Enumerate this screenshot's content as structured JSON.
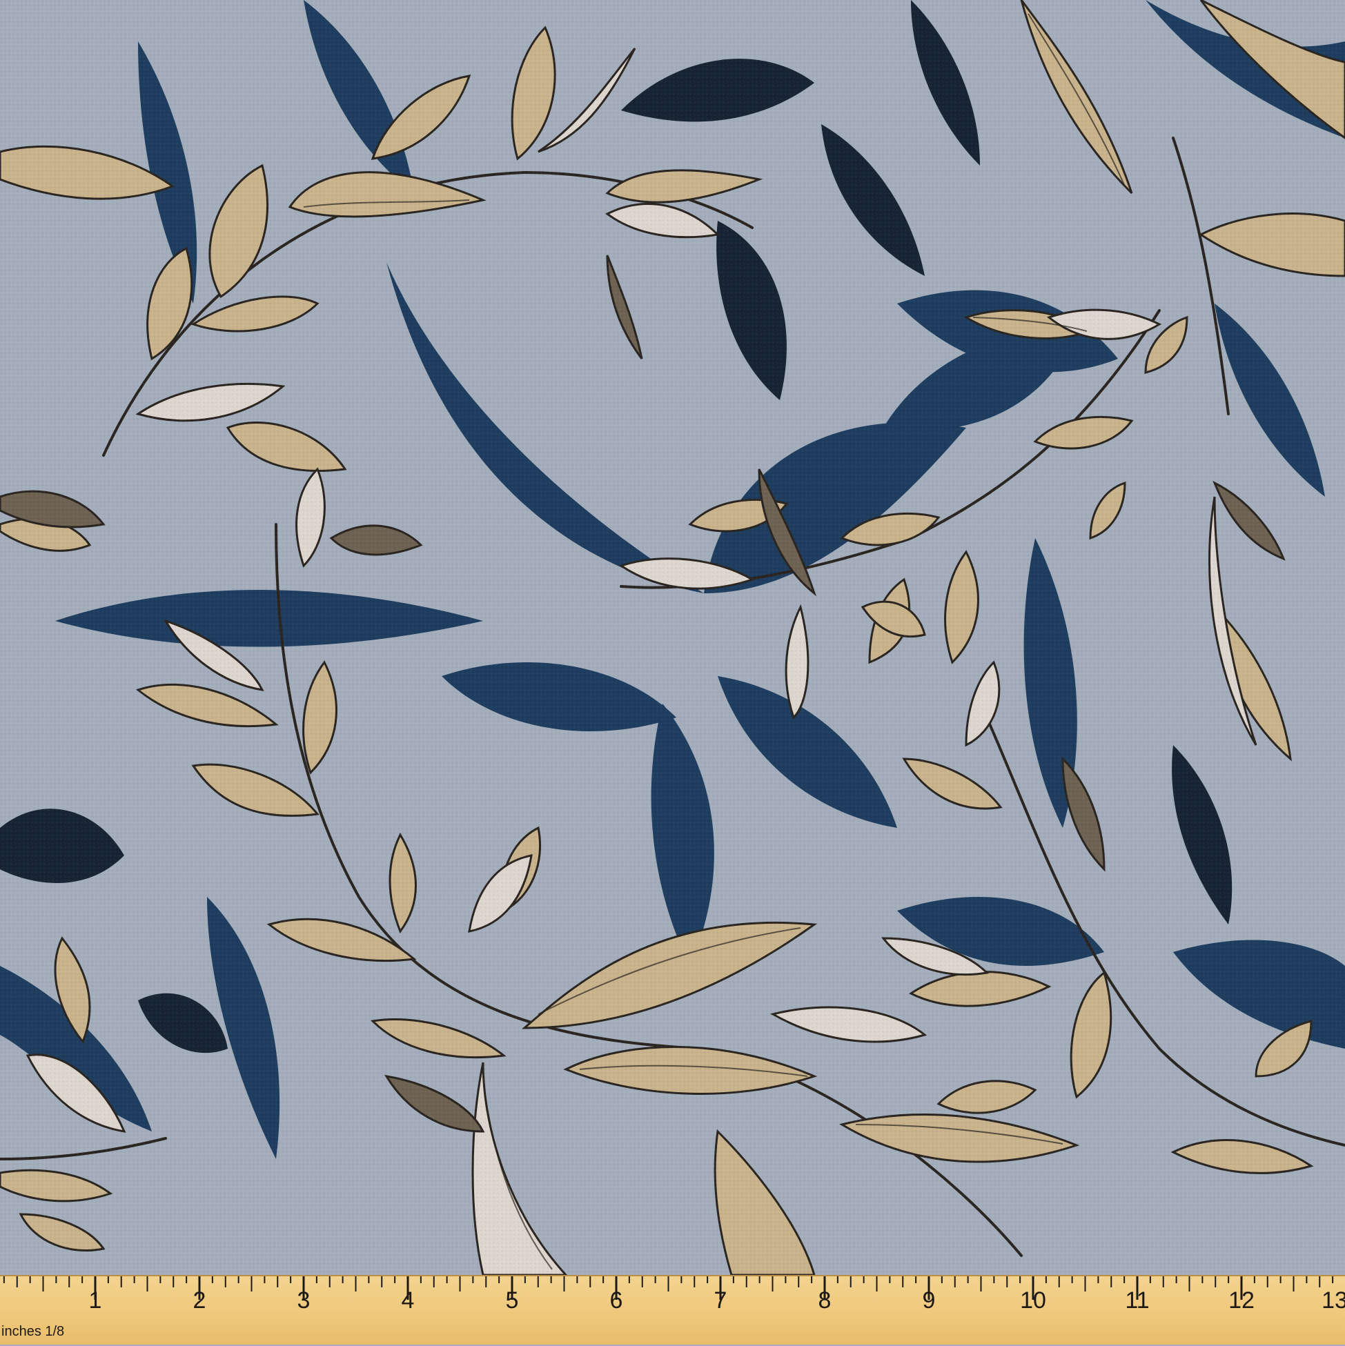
{
  "image": {
    "description_kind": "fabric swatch",
    "colors": {
      "background": "#a3adbb",
      "navy_leaf": "#1e3d5f",
      "dark_leaf": "#172433",
      "tan_leaf": "#c8b38c",
      "light_leaf": "#ddd6cf",
      "brown_leaf": "#6e6253",
      "outline": "#2a2520",
      "ruler": "#efc77a"
    }
  },
  "ruler": {
    "unit_label": "inches 1/8",
    "numbers": [
      "1",
      "2",
      "3",
      "4",
      "5",
      "6",
      "7",
      "8",
      "9",
      "10",
      "11",
      "12",
      "13"
    ]
  }
}
